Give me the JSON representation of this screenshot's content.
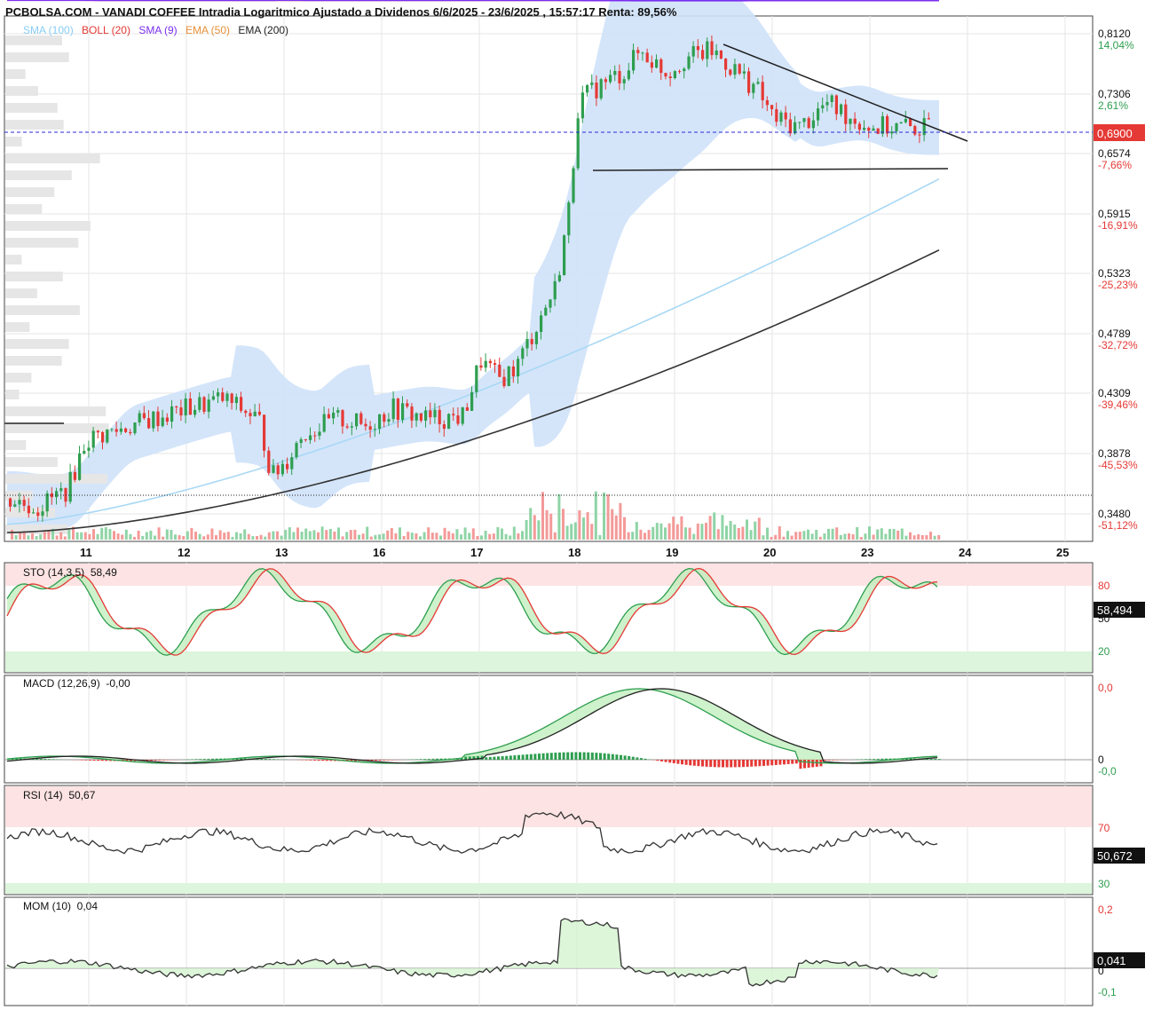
{
  "header": {
    "title": "PCBOLSA.COM - VANADI COFFEE Intradia Logaritmico Ajustado a Dividenos 6/6/2025 - 23/6/2025 , 15:57:17 Renta: 89,56%"
  },
  "legend": [
    {
      "text": "SMA (100)",
      "color": "#87cdf5"
    },
    {
      "text": "BOLL (20)",
      "color": "#e53935"
    },
    {
      "text": "SMA (9)",
      "color": "#7b2ff0"
    },
    {
      "text": "EMA (50)",
      "color": "#e69138"
    },
    {
      "text": "EMA (200)",
      "color": "#222222"
    }
  ],
  "colors": {
    "up": "#2e9e4f",
    "down": "#e53935",
    "band": "#cfe2fa",
    "sma100": "#a8d8f5",
    "boll": "#e53935",
    "sma9": "#7b2ff0",
    "ema50": "#e69138",
    "ema200": "#333333",
    "current": "#e53935"
  },
  "price_axis": {
    "ticks": [
      {
        "price": "0,8120",
        "pct": "14,04%",
        "pct_color": "#2e9e4f"
      },
      {
        "price": "0,7306",
        "pct": "2,61%",
        "pct_color": "#2e9e4f"
      },
      {
        "price": "0,6574",
        "pct": "-7,66%",
        "pct_color": "#e53935"
      },
      {
        "price": "0,5915",
        "pct": "-16,91%",
        "pct_color": "#e53935"
      },
      {
        "price": "0,5323",
        "pct": "-25,23%",
        "pct_color": "#e53935"
      },
      {
        "price": "0,4789",
        "pct": "-32,72%",
        "pct_color": "#e53935"
      },
      {
        "price": "0,4309",
        "pct": "-39,46%",
        "pct_color": "#e53935"
      },
      {
        "price": "0,3878",
        "pct": "-45,53%",
        "pct_color": "#e53935"
      },
      {
        "price": "0,3480",
        "pct": "-51,12%",
        "pct_color": "#e53935"
      }
    ],
    "current_price": "0,6900"
  },
  "x_axis": {
    "labels": [
      "11",
      "12",
      "13",
      "16",
      "17",
      "18",
      "19",
      "20",
      "23",
      "24",
      "25"
    ]
  },
  "indicators": {
    "sto": {
      "label": "STO (14,3,5)",
      "value": "58,49",
      "last": "58,494",
      "levels": [
        "80",
        "50",
        "20"
      ]
    },
    "macd": {
      "label": "MACD (12,26,9)",
      "value": "-0,00",
      "levels": [
        "0,0",
        "0",
        "-0,0"
      ]
    },
    "rsi": {
      "label": "RSI (14)",
      "value": "50,67",
      "last": "50,672",
      "levels": [
        "70",
        "30"
      ]
    },
    "mom": {
      "label": "MOM (10)",
      "value": "0,04",
      "last": "0,041",
      "levels": [
        "0,2",
        "0",
        "-0,1"
      ]
    }
  },
  "chart_data": {
    "type": "candlestick",
    "title": "VANADI COFFEE Intradia Logaritmico Ajustado a Dividenos 6/6/2025 - 23/6/2025",
    "scale": "log",
    "ylim": [
      0.335,
      0.825
    ],
    "x_categories": [
      "11",
      "12",
      "13",
      "16",
      "17",
      "18",
      "19",
      "20",
      "23"
    ],
    "close_points": [
      {
        "x": "10",
        "close": 0.356
      },
      {
        "x": "11",
        "close": 0.395
      },
      {
        "x": "11",
        "close": 0.405
      },
      {
        "x": "12",
        "close": 0.42
      },
      {
        "x": "12",
        "close": 0.425
      },
      {
        "x": "13",
        "close": 0.37
      },
      {
        "x": "13",
        "close": 0.395
      },
      {
        "x": "16",
        "close": 0.415
      },
      {
        "x": "16",
        "close": 0.405
      },
      {
        "x": "17",
        "close": 0.41
      },
      {
        "x": "17",
        "close": 0.455
      },
      {
        "x": "18",
        "close": 0.5
      },
      {
        "x": "18",
        "close": 0.74
      },
      {
        "x": "19",
        "close": 0.79
      },
      {
        "x": "19",
        "close": 0.78
      },
      {
        "x": "20",
        "close": 0.69
      },
      {
        "x": "20",
        "close": 0.7
      },
      {
        "x": "23",
        "close": 0.69
      },
      {
        "x": "23",
        "close": 0.69
      }
    ],
    "current_price": 0.69,
    "renta_pct": 89.56,
    "series": [
      {
        "name": "SMA (100)"
      },
      {
        "name": "BOLL (20)"
      },
      {
        "name": "SMA (9)"
      },
      {
        "name": "EMA (50)"
      },
      {
        "name": "EMA (200)"
      }
    ],
    "indicators": {
      "STO (14,3,5)": 58.494,
      "MACD (12,26,9)": -0.0,
      "RSI (14)": 50.672,
      "MOM (10)": 0.041
    },
    "grid": true
  }
}
